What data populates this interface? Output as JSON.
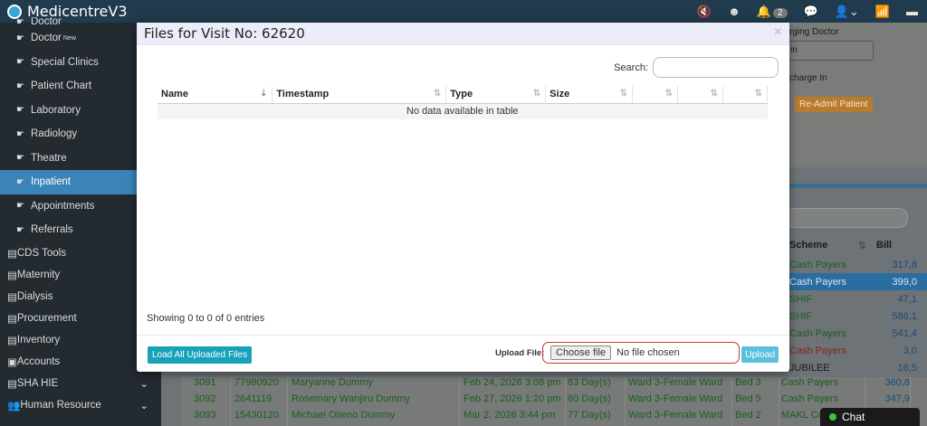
{
  "app": {
    "title": "MedicentreV3",
    "notification_count": "2"
  },
  "sidebar": {
    "items": [
      {
        "label": "Doctor"
      },
      {
        "label": "Doctor",
        "sup": "New"
      },
      {
        "label": "Special Clinics"
      },
      {
        "label": "Patient Chart"
      },
      {
        "label": "Laboratory"
      },
      {
        "label": "Radiology"
      },
      {
        "label": "Theatre"
      },
      {
        "label": "Inpatient"
      },
      {
        "label": "Appointments"
      },
      {
        "label": "Referrals"
      }
    ],
    "groups": [
      {
        "label": "CDS Tools"
      },
      {
        "label": "Maternity"
      },
      {
        "label": "Dialysis"
      },
      {
        "label": "Procurement"
      },
      {
        "label": "Inventory"
      },
      {
        "label": "Accounts"
      },
      {
        "label": "SHA HIE",
        "chevron": "⌄"
      },
      {
        "label": "Human Resource",
        "chevron": "⌄"
      }
    ]
  },
  "background": {
    "label_top": "rging Doctor",
    "select_value": "in",
    "label_discharge": "charge In",
    "readmit_label": "Re-Admit Patient",
    "col_scheme": "Scheme",
    "col_bill": "Bill",
    "rows": [
      {
        "scheme": "Cash Payers",
        "bill": "317,8",
        "color": "#1b5e20"
      },
      {
        "scheme": "Cash Payers",
        "bill": "399,0",
        "color": "#d7e7f3"
      },
      {
        "scheme": "SHIF",
        "bill": "47,1",
        "color": "#1b5e20"
      },
      {
        "scheme": "SHIF",
        "bill": "586,1",
        "color": "#1b5e20"
      },
      {
        "scheme": "Cash Payers",
        "bill": "541,4",
        "color": "#1b5e20"
      },
      {
        "scheme": "Cash Payers",
        "bill": "3,0",
        "color": "#a52a2a"
      },
      {
        "scheme": "JUBILEE",
        "bill": "16,5",
        "color": "#1b1b1b"
      }
    ],
    "bottom_rows": [
      {
        "id": "3091",
        "num": "77980920",
        "name": "Maryanne Dummy",
        "date": "Feb 24, 2026 3:08 pm",
        "days": "83 Day(s)",
        "ward": "Ward 3-Female Ward",
        "bed": "Bed 3",
        "scheme": "Cash Payers",
        "bill": "360,8"
      },
      {
        "id": "3092",
        "num": "2641119",
        "name": "Rosemary Wanjiru Dummy",
        "date": "Feb 27, 2026 1:20 pm",
        "days": "80 Day(s)",
        "ward": "Ward 3-Female Ward",
        "bed": "Bed 5",
        "scheme": "Cash Payers",
        "bill": "347,9"
      },
      {
        "id": "3093",
        "num": "15430120",
        "name": "Michael Otieno Dummy",
        "date": "Mar 2, 2026 3:44 pm",
        "days": "77 Day(s)",
        "ward": "Ward 3-Female Ward",
        "bed": "Bed 2",
        "scheme": "MAKL Co",
        "bill": ""
      }
    ],
    "chat_label": "Chat"
  },
  "modal": {
    "title": "Files for Visit No: 62620",
    "close": "×",
    "search_label": "Search:",
    "columns": [
      "Name",
      "Timestamp",
      "Type",
      "Size",
      "",
      "",
      ""
    ],
    "empty_text": "No data available in table",
    "info_text": "Showing 0 to 0 of 0 entries",
    "load_button": "Load All Uploaded Files",
    "upload_label": "Upload File:",
    "choose_file": "Choose file",
    "no_file": "No file chosen",
    "upload_button": "Upload"
  }
}
